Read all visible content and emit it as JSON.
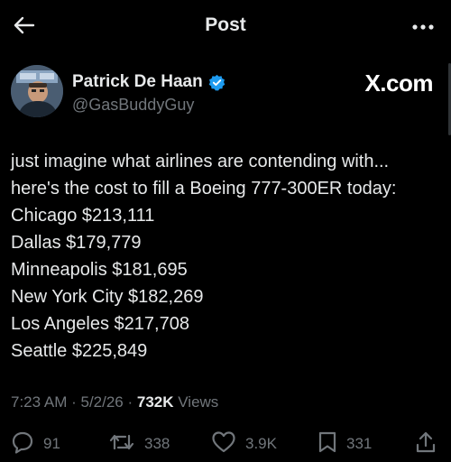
{
  "header": {
    "title": "Post",
    "back_icon": "arrow-left-icon",
    "more_icon": "more-horizontal-icon"
  },
  "author": {
    "display_name": "Patrick De Haan",
    "handle": "@GasBuddyGuy",
    "verified": true,
    "verified_color": "#1d9bf0"
  },
  "source_tag": "X.com",
  "tweet": {
    "lines": [
      "just imagine what airlines are contending with...",
      "here's the cost to fill a Boeing 777-300ER today:",
      "Chicago $213,111",
      "Dallas $179,779",
      "Minneapolis $181,695",
      "New York City $182,269",
      "Los Angeles $217,708",
      "Seattle $225,849"
    ]
  },
  "meta": {
    "time": "7:23 AM",
    "date": "5/2/26",
    "views_count": "732K",
    "views_label": "Views"
  },
  "actions": {
    "replies": "91",
    "reposts": "338",
    "likes": "3.9K",
    "bookmarks": "331"
  },
  "colors": {
    "background": "#000000",
    "text": "#e7e9ea",
    "secondary": "#71767b"
  }
}
